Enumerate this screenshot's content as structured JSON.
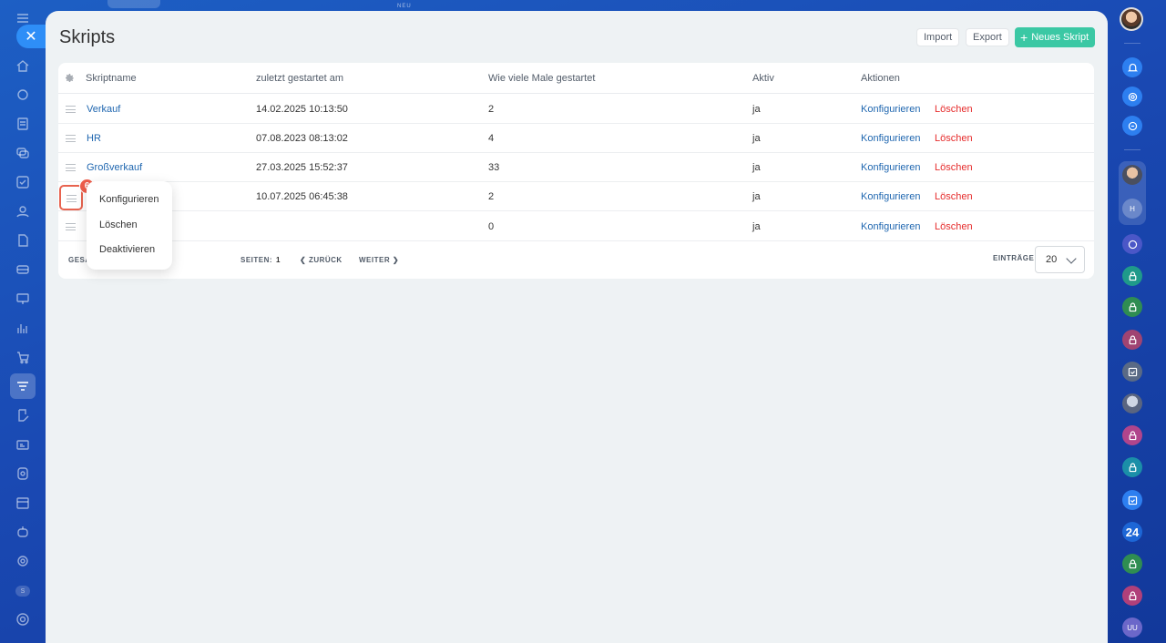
{
  "topbar": {
    "new_label": "NEU"
  },
  "header": {
    "title": "Skripts",
    "import_label": "Import",
    "export_label": "Export",
    "new_script_label": "Neues Skript",
    "accent": "#3bc8a4"
  },
  "table": {
    "columns": {
      "name": "Skriptname",
      "last_started": "zuletzt gestartet am",
      "times_started": "Wie viele Male gestartet",
      "active": "Aktiv",
      "actions": "Aktionen"
    },
    "rows": [
      {
        "name": "Verkauf",
        "last_started": "14.02.2025 10:13:50",
        "count": "2",
        "active": "ja",
        "configure": "Konfigurieren",
        "delete": "Löschen"
      },
      {
        "name": "HR",
        "last_started": "07.08.2023 08:13:02",
        "count": "4",
        "active": "ja",
        "configure": "Konfigurieren",
        "delete": "Löschen"
      },
      {
        "name": "Großverkauf",
        "last_started": "27.03.2025 15:52:37",
        "count": "33",
        "active": "ja",
        "configure": "Konfigurieren",
        "delete": "Löschen"
      },
      {
        "name": "",
        "last_started": "10.07.2025 06:45:38",
        "count": "2",
        "active": "ja",
        "configure": "Konfigurieren",
        "delete": "Löschen"
      },
      {
        "name": "",
        "last_started": "",
        "count": "0",
        "active": "ja",
        "configure": "Konfigurieren",
        "delete": "Löschen"
      }
    ]
  },
  "footer": {
    "total_label": "GESA",
    "pages_label": "SEITEN:",
    "page_number": "1",
    "back_label": "ZURÜCK",
    "next_label": "WEITER",
    "entries_label": "EINTRÄGE",
    "entries_value": "20"
  },
  "context_menu": {
    "badge": "6",
    "items": [
      "Konfigurieren",
      "Löschen",
      "Deaktivieren"
    ]
  },
  "right_rail": {
    "badge_24": "24",
    "avatar_h": "H",
    "avatar_uu": "UU"
  },
  "left_nav": {
    "avatar_s": "S"
  }
}
